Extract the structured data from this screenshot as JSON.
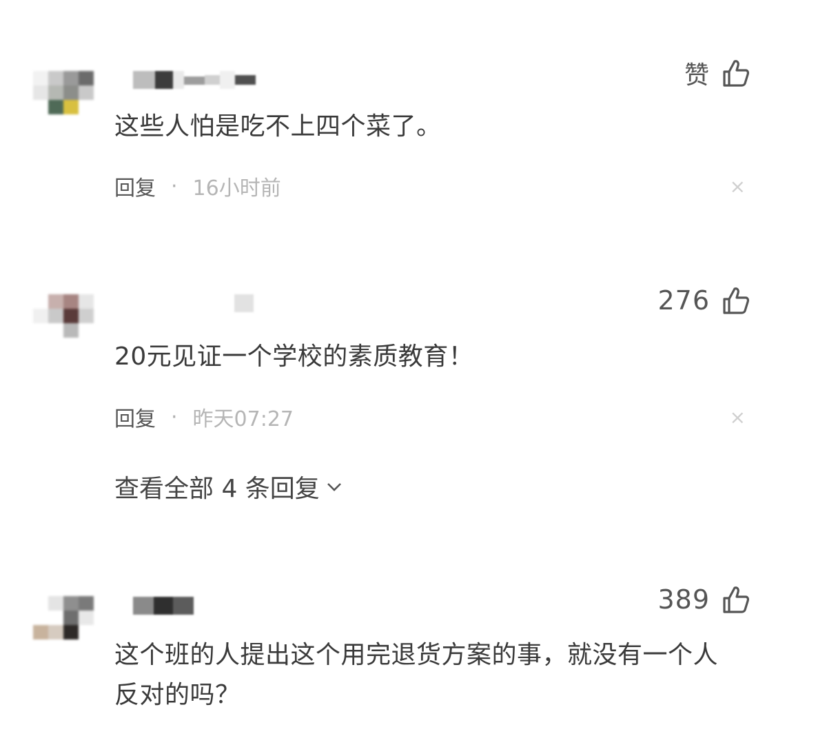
{
  "comments": [
    {
      "like_label": "赞",
      "text": "这些人怕是吃不上四个菜了。",
      "reply_label": "回复",
      "separator": "·",
      "time": "16小时前",
      "close_glyph": "×"
    },
    {
      "like_label": "276",
      "text": "20元见证一个学校的素质教育！",
      "reply_label": "回复",
      "separator": "·",
      "time": "昨天07:27",
      "close_glyph": "×",
      "expand_label": "查看全部 4 条回复"
    },
    {
      "like_label": "389",
      "text": "这个班的人提出这个用完退货方案的事，就没有一个人反对的吗？"
    }
  ],
  "icons": {
    "like": "thumbs-up-icon",
    "close": "close-icon",
    "expand": "chevron-down-icon"
  }
}
